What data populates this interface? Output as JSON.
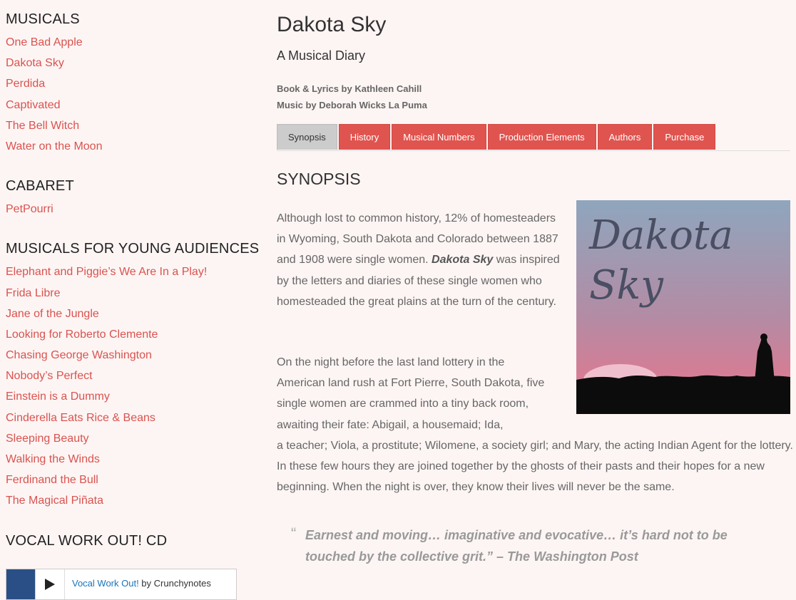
{
  "sidebar": {
    "sections": [
      {
        "heading": "MUSICALS",
        "items": [
          "One Bad Apple",
          "Dakota Sky",
          "Perdida",
          "Captivated",
          "The Bell Witch",
          "Water on the Moon"
        ]
      },
      {
        "heading": "CABARET",
        "items": [
          "PetPourri"
        ]
      },
      {
        "heading": "MUSICALS FOR YOUNG AUDIENCES",
        "items": [
          "Elephant and Piggie’s We Are In a Play!",
          "Frida Libre",
          "Jane of the Jungle",
          "Looking for Roberto Clemente",
          "Chasing George Washington",
          "Nobody’s Perfect",
          "Einstein is a Dummy",
          "Cinderella Eats Rice & Beans",
          "Sleeping Beauty",
          "Walking the Winds",
          "Ferdinand the Bull",
          "The Magical Piñata"
        ]
      },
      {
        "heading": "VOCAL WORK OUT! CD",
        "items": []
      }
    ],
    "player": {
      "link": "Vocal Work Out!",
      "by": " by Crunchynotes",
      "play_icon": "play-icon"
    }
  },
  "main": {
    "title": "Dakota Sky",
    "subtitle": "A Musical Diary",
    "credit_book": "Book & Lyrics by Kathleen Cahill",
    "credit_music": "Music by Deborah Wicks La Puma",
    "tabs": [
      "Synopsis",
      "History",
      "Musical Numbers",
      "Production Elements",
      "Authors",
      "Purchase"
    ],
    "active_tab": "Synopsis",
    "section_title": "SYNOPSIS",
    "p1_before": "Although lost to common history, 12% of homesteaders in Wyoming, South Dakota and Colorado between 1887 and 1908 were single women. ",
    "p1_em": "Dakota Sky",
    "p1_after": " was inspired by the letters and diaries of these single women who homesteaded the great plains at the turn of the century.",
    "p2_part1": "On the night before the last land lottery in the American land rush at Fort Pierre, South Dakota, five single women are crammed into a tiny back room, awaiting their fate: Abigail, a housemaid; Ida,",
    "p2_part2": "a teacher; Viola, a prostitute; Wilomene, a society girl; and Mary, the acting Indian Agent for the lottery. In these few hours they are joined together by the ghosts of their pasts and their hopes for a new beginning. When the night is over, they know their lives will never be the same.",
    "quote": "Earnest and moving… imaginative and evocative… it’s hard not to be touched by the collective grit.” – The Washington Post",
    "quote_mark": "“",
    "poster": {
      "line1": "Dakota",
      "line2": "Sky"
    }
  },
  "colors": {
    "accent": "#e0544f",
    "link": "#d9534f",
    "background": "#fdf5f4"
  }
}
